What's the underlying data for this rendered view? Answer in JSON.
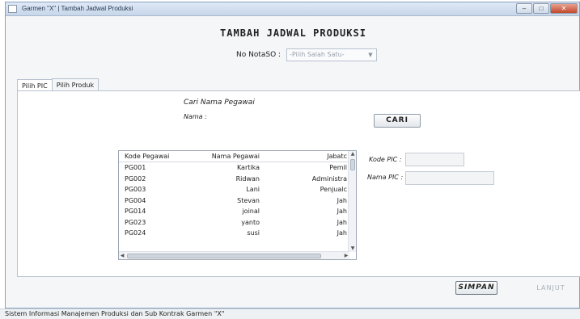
{
  "window": {
    "title": "Garmen \"X\" | Tambah Jadwal Produksi",
    "controls": {
      "minimize": "–",
      "maximize": "□",
      "close": "✕"
    }
  },
  "heading": "TAMBAH JADWAL PRODUKSI",
  "nota": {
    "label": "No NotaSO :",
    "select_value": "-Pilih Salah Satu-"
  },
  "tabs": [
    {
      "label": "Pilih PIC"
    },
    {
      "label": "Pilih Produk"
    }
  ],
  "search": {
    "caption": "Cari Nama Pegawai",
    "label": "Nama :",
    "value": "",
    "button_label": "CARI"
  },
  "table": {
    "headers": [
      "Kode Pegawai",
      "Nama Pegawai",
      "Jabatc"
    ],
    "rows": [
      [
        "PG001",
        "Kartika",
        "Pemil"
      ],
      [
        "PG002",
        "Ridwan",
        "Administra"
      ],
      [
        "PG003",
        "Lani",
        "Penjualc"
      ],
      [
        "PG004",
        "Stevan",
        "Jah"
      ],
      [
        "PG014",
        "joinal",
        "Jah"
      ],
      [
        "PG023",
        "yanto",
        "Jah"
      ],
      [
        "PG024",
        "susi",
        "Jah"
      ]
    ]
  },
  "pic": {
    "kode_label": "Kode PIC :",
    "kode_value": "",
    "nama_label": "Nama PIC :",
    "nama_value": ""
  },
  "buttons": {
    "simpan": "SIMPAN",
    "lanjut": "LANJUT"
  },
  "statusbar": "Sistem Informasi Manajemen Produksi dan Sub Kontrak Garmen \"X\""
}
